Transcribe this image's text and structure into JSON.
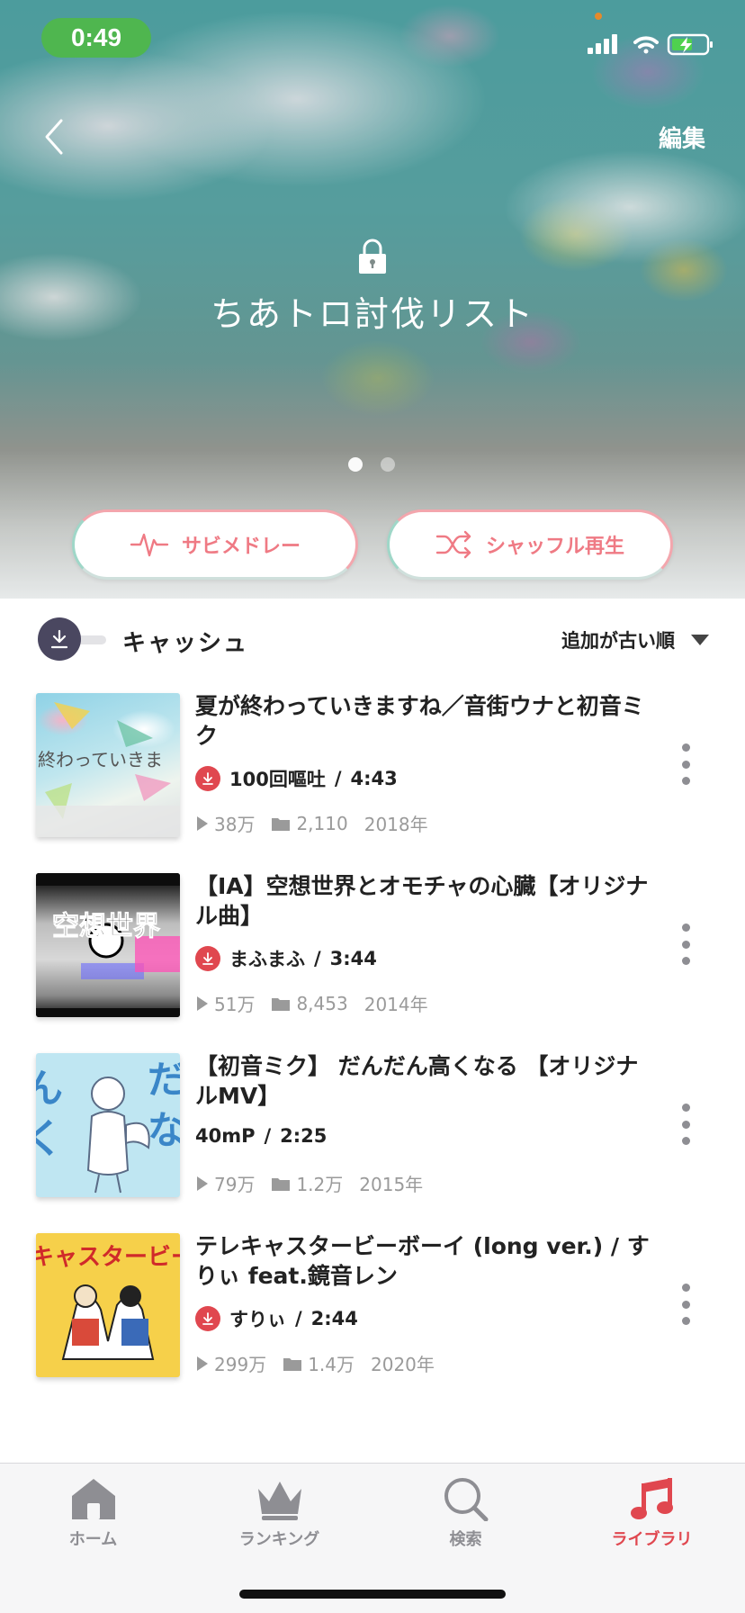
{
  "status_bar": {
    "time": "0:49"
  },
  "header": {
    "edit_label": "編集"
  },
  "playlist": {
    "title": "ちあトロ討伐リスト",
    "pages": 2,
    "active_page": 1
  },
  "actions": {
    "medley_label": "サビメドレー",
    "shuffle_label": "シャッフル再生"
  },
  "list_header": {
    "cache_label": "キャッシュ",
    "sort_label": "追加が古い順"
  },
  "tracks": [
    {
      "title": "夏が終わっていきますね／音街ウナと初音ミク",
      "artist": "100回嘔吐",
      "duration": "4:43",
      "downloaded": true,
      "plays": "38万",
      "mylists": "2,110",
      "year": "2018年",
      "thumb_text": "終わっていきま"
    },
    {
      "title": "【IA】空想世界とオモチャの心臓【オリジナル曲】",
      "artist": "まふまふ",
      "duration": "3:44",
      "downloaded": true,
      "plays": "51万",
      "mylists": "8,453",
      "year": "2014年",
      "thumb_text": "空想世界"
    },
    {
      "title": "【初音ミク】 だんだん高くなる 【オリジナルMV】",
      "artist": "40mP",
      "duration": "2:25",
      "downloaded": false,
      "plays": "79万",
      "mylists": "1.2万",
      "year": "2015年",
      "thumb_text": "だんだん"
    },
    {
      "title": "テレキャスタービーボーイ (long ver.) / すりぃ feat.鏡音レン",
      "artist": "すりぃ",
      "duration": "2:44",
      "downloaded": true,
      "plays": "299万",
      "mylists": "1.4万",
      "year": "2020年",
      "thumb_text": "キャスタービーボ"
    }
  ],
  "tabs": [
    {
      "label": "ホーム",
      "icon": "home-icon",
      "active": false
    },
    {
      "label": "ランキング",
      "icon": "crown-icon",
      "active": false
    },
    {
      "label": "検索",
      "icon": "search-icon",
      "active": false
    },
    {
      "label": "ライブラリ",
      "icon": "music-note-icon",
      "active": true
    }
  ],
  "colors": {
    "accent": "#e0474f",
    "button_text": "#ef7a84",
    "status_pill": "#4fb64f"
  }
}
